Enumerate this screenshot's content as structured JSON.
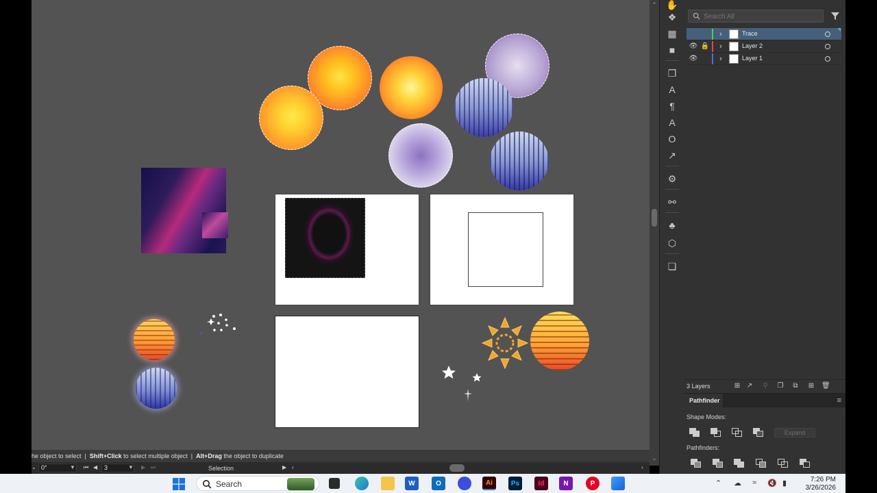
{
  "layers_panel": {
    "search_placeholder": "Search All",
    "layers": [
      {
        "name": "Trace",
        "color": "#4cd14c",
        "visible": false,
        "locked": false,
        "selected": true
      },
      {
        "name": "Layer 2",
        "color": "#e04848",
        "visible": true,
        "locked": true,
        "selected": false
      },
      {
        "name": "Layer 1",
        "color": "#4a6fe0",
        "visible": true,
        "locked": false,
        "selected": false
      }
    ],
    "count_label": "3 Layers"
  },
  "pathfinder": {
    "tab_label": "Pathfinder",
    "shape_modes_label": "Shape Modes:",
    "pathfinders_label": "Pathfinders:",
    "expand_label": "Expand"
  },
  "status": {
    "hint_pre": "he object to select",
    "hint_shift": "Shift+Click",
    "hint_shift_text": "to select multiple object",
    "hint_alt": "Alt+Drag",
    "hint_alt_text": "the object to duplicate",
    "rotation": "0°",
    "artboard_number": "3",
    "tool_name": "Selection"
  },
  "taskbar": {
    "search_label": "Search",
    "time": "7:26 PM",
    "date": "3/26/2026",
    "apps": [
      {
        "name": "Ai",
        "color": "#330000",
        "fg": "#ff9a00"
      },
      {
        "name": "Ps",
        "color": "#001e36",
        "fg": "#31a8ff"
      },
      {
        "name": "Id",
        "color": "#49021f",
        "fg": "#ff3366"
      },
      {
        "name": "N",
        "color": "#7719aa",
        "fg": "#ffffff"
      }
    ]
  },
  "colors": {
    "canvas": "#535353",
    "panel": "#323232",
    "selected_row": "#46607c"
  }
}
